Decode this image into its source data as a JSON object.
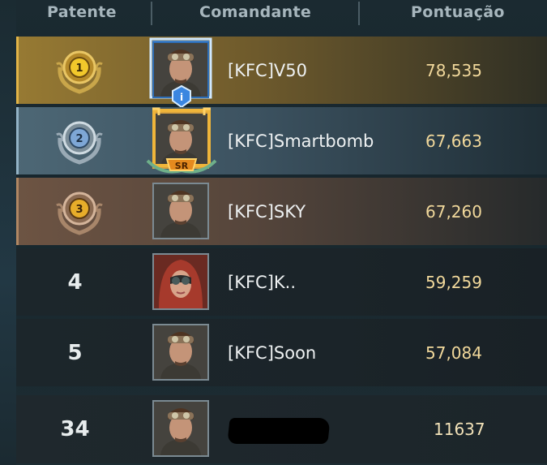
{
  "header": {
    "rank": "Patente",
    "commander": "Comandante",
    "score": "Pontuação"
  },
  "rows": [
    {
      "rank": "1",
      "name": "[KFC]V50",
      "score": "78,535",
      "medal": "gold-medal-icon",
      "badge": "i"
    },
    {
      "rank": "2",
      "name": "[KFC]Smartbomb",
      "score": "67,663",
      "medal": "silver-medal-icon",
      "badge": "SR"
    },
    {
      "rank": "3",
      "name": "[KFC]SKY",
      "score": "67,260",
      "medal": "bronze-medal-icon"
    },
    {
      "rank": "4",
      "name": "[KFC]K..",
      "score": "59,259"
    },
    {
      "rank": "5",
      "name": "[KFC]Soon",
      "score": "57,084"
    }
  ],
  "self": {
    "rank": "34",
    "name": "",
    "score": "11637"
  },
  "colors": {
    "gold": "#e2b447",
    "silver": "#93b3c6",
    "bronze": "#b08763",
    "score": "#f1d89b"
  }
}
